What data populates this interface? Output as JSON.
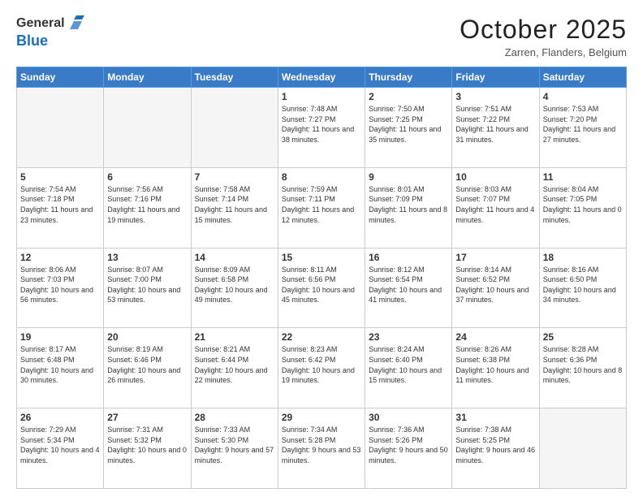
{
  "header": {
    "logo_general": "General",
    "logo_blue": "Blue",
    "month_title": "October 2025",
    "location": "Zarren, Flanders, Belgium"
  },
  "weekdays": [
    "Sunday",
    "Monday",
    "Tuesday",
    "Wednesday",
    "Thursday",
    "Friday",
    "Saturday"
  ],
  "weeks": [
    [
      {
        "day": "",
        "empty": true
      },
      {
        "day": "",
        "empty": true
      },
      {
        "day": "",
        "empty": true
      },
      {
        "day": "1",
        "sunrise": "7:48 AM",
        "sunset": "7:27 PM",
        "daylight": "11 hours and 38 minutes."
      },
      {
        "day": "2",
        "sunrise": "7:50 AM",
        "sunset": "7:25 PM",
        "daylight": "11 hours and 35 minutes."
      },
      {
        "day": "3",
        "sunrise": "7:51 AM",
        "sunset": "7:22 PM",
        "daylight": "11 hours and 31 minutes."
      },
      {
        "day": "4",
        "sunrise": "7:53 AM",
        "sunset": "7:20 PM",
        "daylight": "11 hours and 27 minutes."
      }
    ],
    [
      {
        "day": "5",
        "sunrise": "7:54 AM",
        "sunset": "7:18 PM",
        "daylight": "11 hours and 23 minutes."
      },
      {
        "day": "6",
        "sunrise": "7:56 AM",
        "sunset": "7:16 PM",
        "daylight": "11 hours and 19 minutes."
      },
      {
        "day": "7",
        "sunrise": "7:58 AM",
        "sunset": "7:14 PM",
        "daylight": "11 hours and 15 minutes."
      },
      {
        "day": "8",
        "sunrise": "7:59 AM",
        "sunset": "7:11 PM",
        "daylight": "11 hours and 12 minutes."
      },
      {
        "day": "9",
        "sunrise": "8:01 AM",
        "sunset": "7:09 PM",
        "daylight": "11 hours and 8 minutes."
      },
      {
        "day": "10",
        "sunrise": "8:03 AM",
        "sunset": "7:07 PM",
        "daylight": "11 hours and 4 minutes."
      },
      {
        "day": "11",
        "sunrise": "8:04 AM",
        "sunset": "7:05 PM",
        "daylight": "11 hours and 0 minutes."
      }
    ],
    [
      {
        "day": "12",
        "sunrise": "8:06 AM",
        "sunset": "7:03 PM",
        "daylight": "10 hours and 56 minutes."
      },
      {
        "day": "13",
        "sunrise": "8:07 AM",
        "sunset": "7:00 PM",
        "daylight": "10 hours and 53 minutes."
      },
      {
        "day": "14",
        "sunrise": "8:09 AM",
        "sunset": "6:58 PM",
        "daylight": "10 hours and 49 minutes."
      },
      {
        "day": "15",
        "sunrise": "8:11 AM",
        "sunset": "6:56 PM",
        "daylight": "10 hours and 45 minutes."
      },
      {
        "day": "16",
        "sunrise": "8:12 AM",
        "sunset": "6:54 PM",
        "daylight": "10 hours and 41 minutes."
      },
      {
        "day": "17",
        "sunrise": "8:14 AM",
        "sunset": "6:52 PM",
        "daylight": "10 hours and 37 minutes."
      },
      {
        "day": "18",
        "sunrise": "8:16 AM",
        "sunset": "6:50 PM",
        "daylight": "10 hours and 34 minutes."
      }
    ],
    [
      {
        "day": "19",
        "sunrise": "8:17 AM",
        "sunset": "6:48 PM",
        "daylight": "10 hours and 30 minutes."
      },
      {
        "day": "20",
        "sunrise": "8:19 AM",
        "sunset": "6:46 PM",
        "daylight": "10 hours and 26 minutes."
      },
      {
        "day": "21",
        "sunrise": "8:21 AM",
        "sunset": "6:44 PM",
        "daylight": "10 hours and 22 minutes."
      },
      {
        "day": "22",
        "sunrise": "8:23 AM",
        "sunset": "6:42 PM",
        "daylight": "10 hours and 19 minutes."
      },
      {
        "day": "23",
        "sunrise": "8:24 AM",
        "sunset": "6:40 PM",
        "daylight": "10 hours and 15 minutes."
      },
      {
        "day": "24",
        "sunrise": "8:26 AM",
        "sunset": "6:38 PM",
        "daylight": "10 hours and 11 minutes."
      },
      {
        "day": "25",
        "sunrise": "8:28 AM",
        "sunset": "6:36 PM",
        "daylight": "10 hours and 8 minutes."
      }
    ],
    [
      {
        "day": "26",
        "sunrise": "7:29 AM",
        "sunset": "5:34 PM",
        "daylight": "10 hours and 4 minutes."
      },
      {
        "day": "27",
        "sunrise": "7:31 AM",
        "sunset": "5:32 PM",
        "daylight": "10 hours and 0 minutes."
      },
      {
        "day": "28",
        "sunrise": "7:33 AM",
        "sunset": "5:30 PM",
        "daylight": "9 hours and 57 minutes."
      },
      {
        "day": "29",
        "sunrise": "7:34 AM",
        "sunset": "5:28 PM",
        "daylight": "9 hours and 53 minutes."
      },
      {
        "day": "30",
        "sunrise": "7:36 AM",
        "sunset": "5:26 PM",
        "daylight": "9 hours and 50 minutes."
      },
      {
        "day": "31",
        "sunrise": "7:38 AM",
        "sunset": "5:25 PM",
        "daylight": "9 hours and 46 minutes."
      },
      {
        "day": "",
        "empty": true
      }
    ]
  ]
}
